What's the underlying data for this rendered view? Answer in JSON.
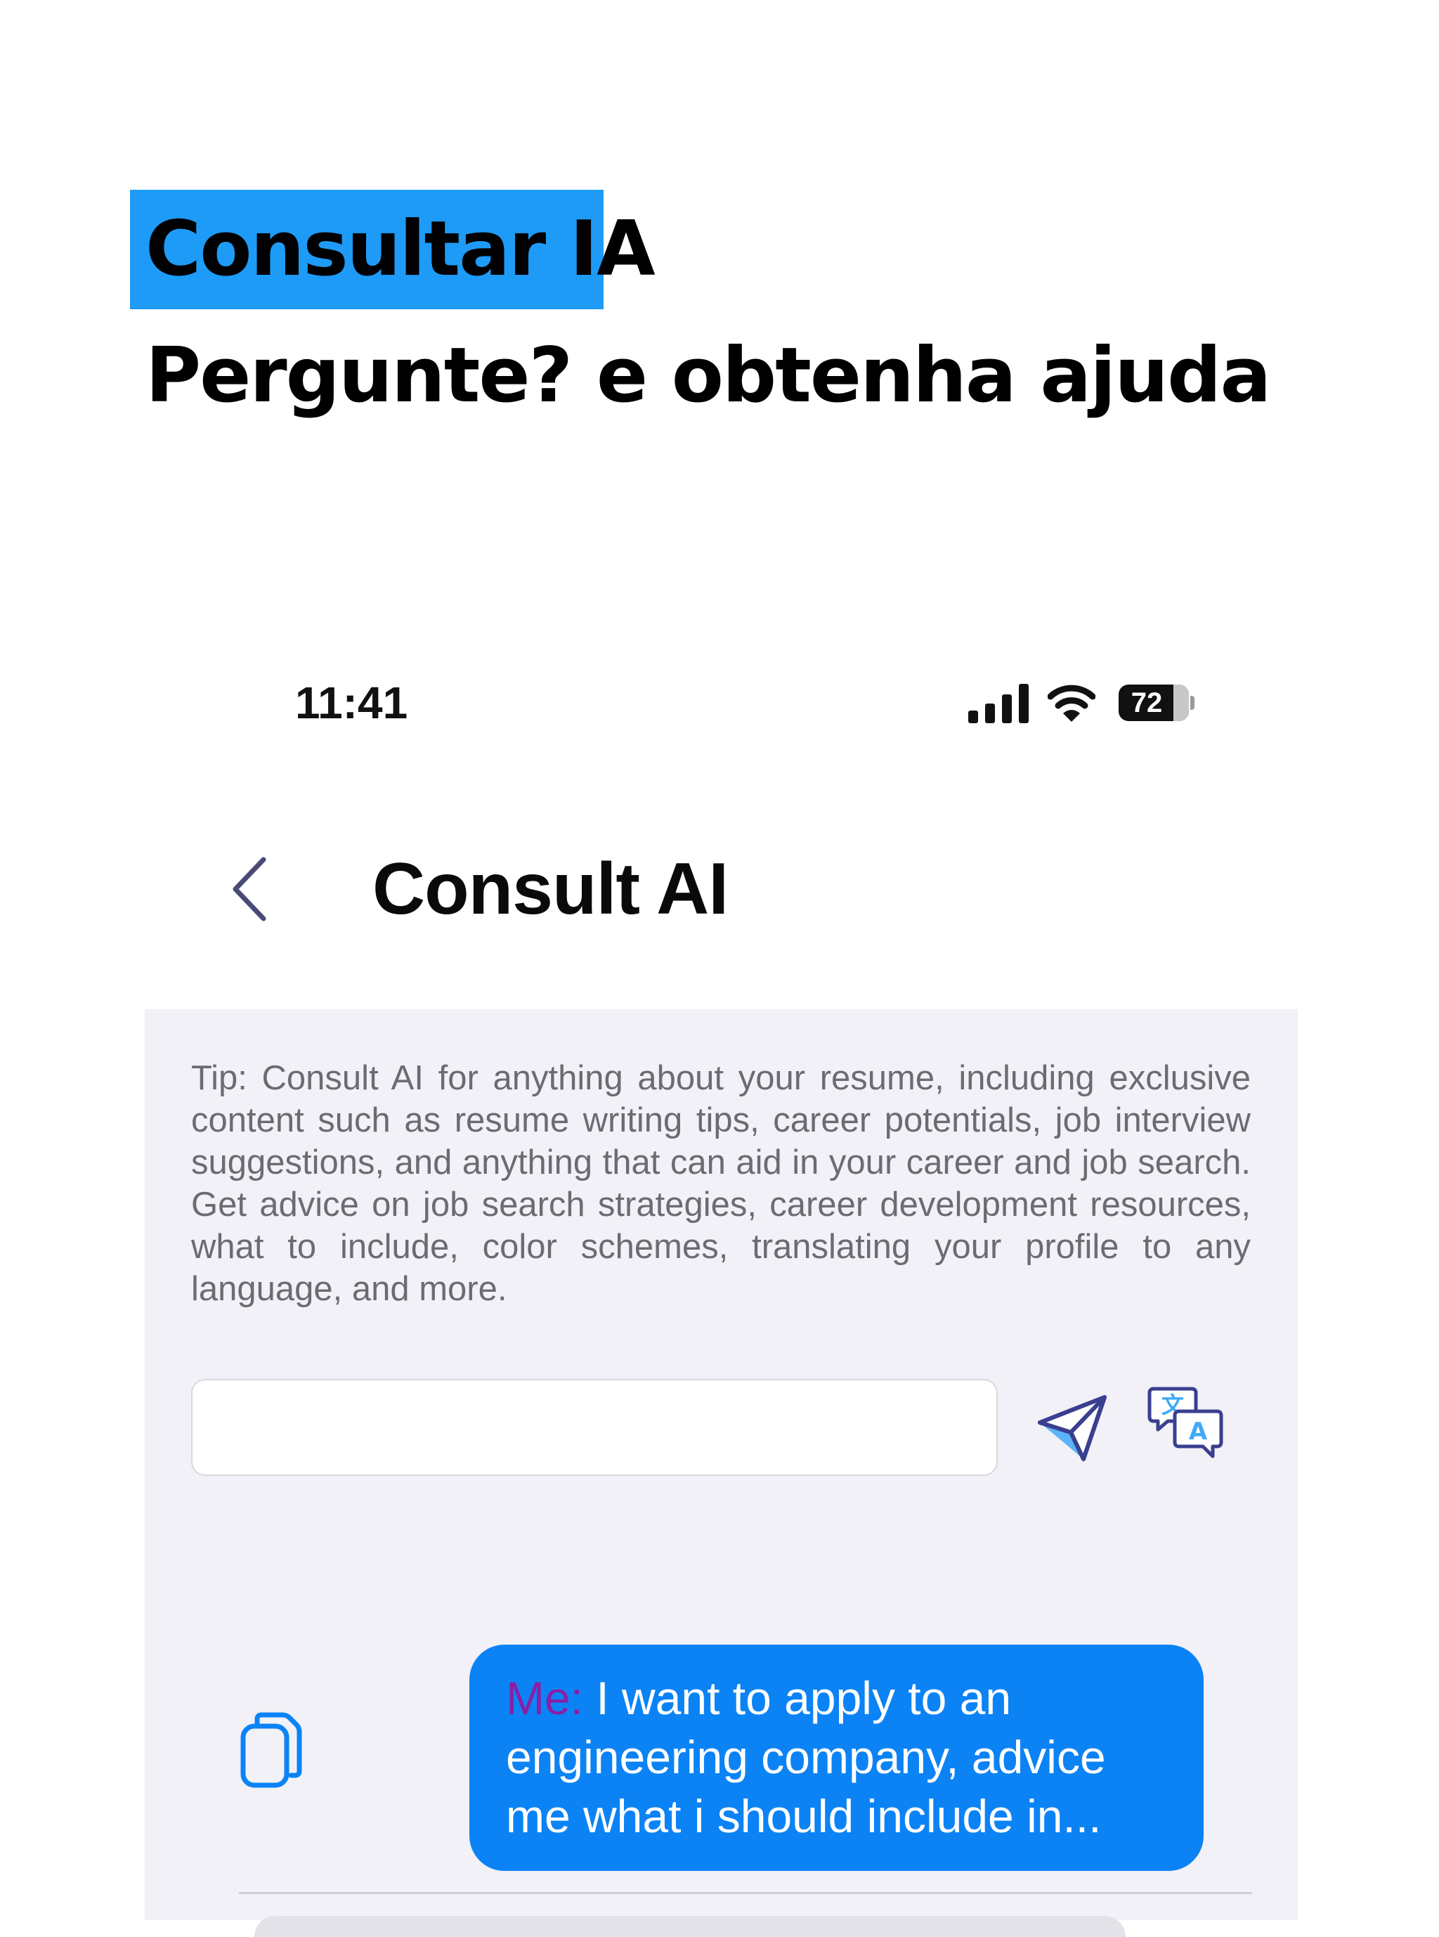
{
  "promo": {
    "title": "Consultar IA",
    "subtitle": "Pergunte? e obtenha ajuda",
    "badge_color": "#1e9bf7"
  },
  "status_bar": {
    "time": "11:41",
    "battery_level": "72",
    "icons": [
      "signal-icon",
      "wifi-icon",
      "battery-icon"
    ]
  },
  "nav": {
    "back_icon": "chevron-left-icon",
    "title": "Consult AI"
  },
  "tip": {
    "text": "Tip: Consult AI for anything about your resume, including exclusive content such as resume writing tips, career potentials, job interview suggestions, and anything that can aid in your career and job search. Get advice on job search strategies, career development resources, what to include, color schemes, translating your profile to any language, and more."
  },
  "input": {
    "value": "",
    "placeholder": ""
  },
  "actions": {
    "send_icon": "paper-plane-icon",
    "translate_icon": "translate-icon",
    "copy_icon": "copy-icon"
  },
  "messages": [
    {
      "sender": "Me:",
      "text": " I want to apply to an engineering company, advice me what i should include in..."
    }
  ],
  "colors": {
    "accent": "#0c83f5",
    "sender_label": "#8a1fa6",
    "panel_background": "#f1f1f7",
    "icon_stroke": "#3a3f8f",
    "icon_fill": "#3fa9f5"
  }
}
